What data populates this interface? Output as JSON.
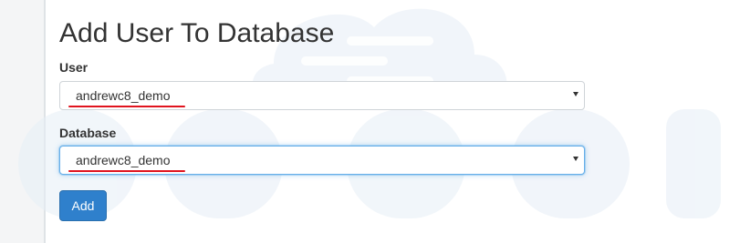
{
  "page": {
    "title": "Add User To Database"
  },
  "form": {
    "user_label": "User",
    "user_value": "andrewc8_demo",
    "database_label": "Database",
    "database_value": "andrewc8_demo",
    "submit_label": "Add"
  },
  "colors": {
    "accent": "#2f80cc",
    "focus_border": "#66afe9",
    "annotation_underline": "#e0141e"
  }
}
